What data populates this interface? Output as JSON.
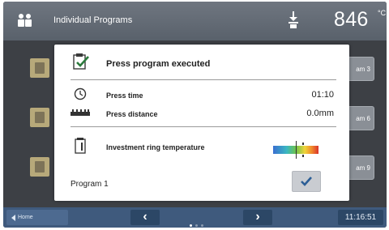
{
  "header": {
    "title": "Individual Programs",
    "temperature": "846",
    "temperature_unit": "°C"
  },
  "programs_visible": [
    "am 3",
    "am 6",
    "am 9"
  ],
  "dialog": {
    "title": "Press program executed",
    "rows": [
      {
        "label": "Press time",
        "value": "01:10"
      },
      {
        "label": "Press distance",
        "value": "0.0mm"
      },
      {
        "label": "Investment ring temperature",
        "value": ""
      }
    ],
    "program_name": "Program 1"
  },
  "footer": {
    "home_label": "Home",
    "clock": "11:16:51"
  },
  "colors": {
    "accent_check": "#2a7a3c",
    "confirm_check": "#2c5e96",
    "footer_bg": "#3f5a7d"
  }
}
